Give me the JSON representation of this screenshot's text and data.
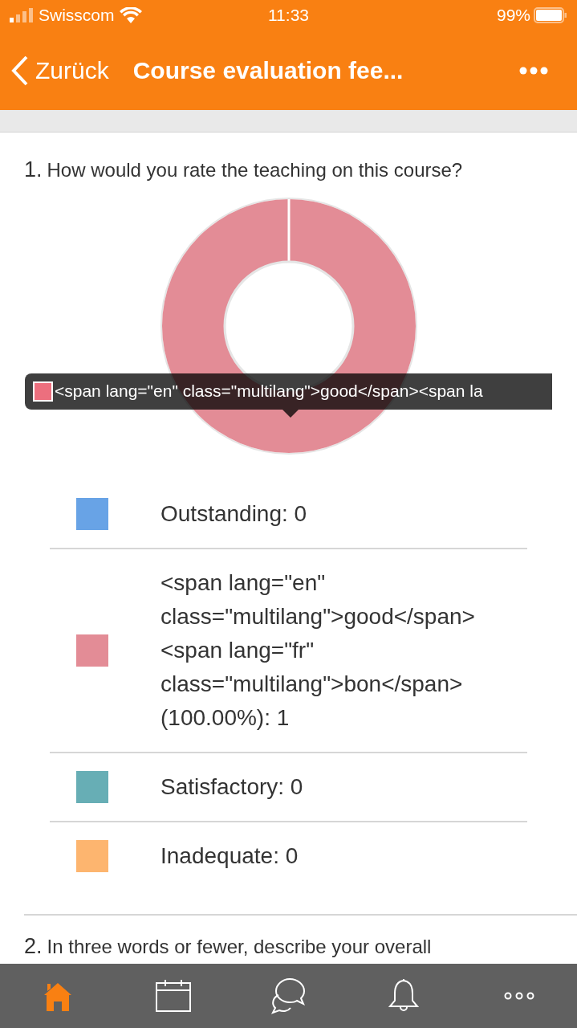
{
  "status_bar": {
    "carrier": "Swisscom",
    "time": "11:33",
    "battery": "99%"
  },
  "nav_bar": {
    "back": "Zurück",
    "title": "Course evaluation fee..."
  },
  "questions": [
    {
      "number": "1.",
      "text": "How would you rate the teaching on this course?",
      "chart_data": {
        "type": "donut",
        "values": [
          0,
          1,
          0,
          0
        ]
      },
      "tooltip": {
        "color": "#ec6f7e",
        "text": "<span lang=\"en\" class=\"multilang\">good</span><span la"
      },
      "legend": [
        {
          "label": "Outstanding: 0",
          "color": "#68a3e6"
        },
        {
          "label": "<span lang=\"en\" class=\"multilang\">good</span><span lang=\"fr\" class=\"multilang\">bon</span> (100.00%): 1",
          "color": "#e38c96"
        },
        {
          "label": "Satisfactory: 0",
          "color": "#67aeb5"
        },
        {
          "label": "Inadequate: 0",
          "color": "#fdb56f"
        }
      ]
    },
    {
      "number": "2.",
      "text": "In three words or fewer, describe your overall"
    }
  ],
  "tab_bar": [
    {
      "kind": "home",
      "selected": true
    },
    {
      "kind": "calendar",
      "selected": false
    },
    {
      "kind": "messages",
      "selected": false
    },
    {
      "kind": "notifications",
      "selected": false
    },
    {
      "kind": "more",
      "selected": false
    }
  ]
}
